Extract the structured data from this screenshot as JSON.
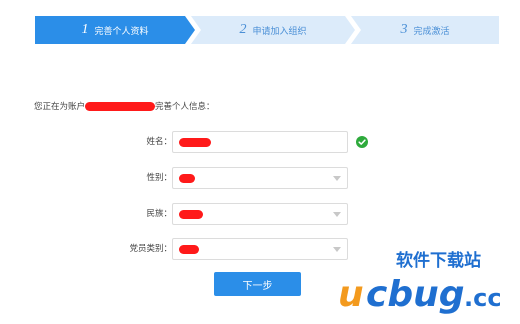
{
  "steps": [
    {
      "number": "1",
      "label": "完善个人资料",
      "state": "active"
    },
    {
      "number": "2",
      "label": "申请加入组织",
      "state": "inactive"
    },
    {
      "number": "3",
      "label": "完成激活",
      "state": "inactive"
    }
  ],
  "intro": {
    "prefix": "您正在为账户",
    "suffix": "完善个人信息："
  },
  "form": {
    "fields": [
      {
        "label": "姓名：",
        "type": "text",
        "status_icon": "check-circle-icon"
      },
      {
        "label": "性别：",
        "type": "select"
      },
      {
        "label": "民族：",
        "type": "select"
      },
      {
        "label": "党员类别：",
        "type": "select"
      }
    ]
  },
  "actions": {
    "next_label": "下一步"
  },
  "watermark": {
    "text": "软件下载站",
    "logo": "ucbug",
    "domain": ".cc"
  },
  "colors": {
    "accent": "#2b8ee8",
    "step_inactive_bg": "#dcebfa",
    "redaction": "#ff1a1a",
    "success": "#2eaa3c",
    "watermark_orange": "#f39a1e",
    "watermark_blue": "#1f6fd0"
  }
}
